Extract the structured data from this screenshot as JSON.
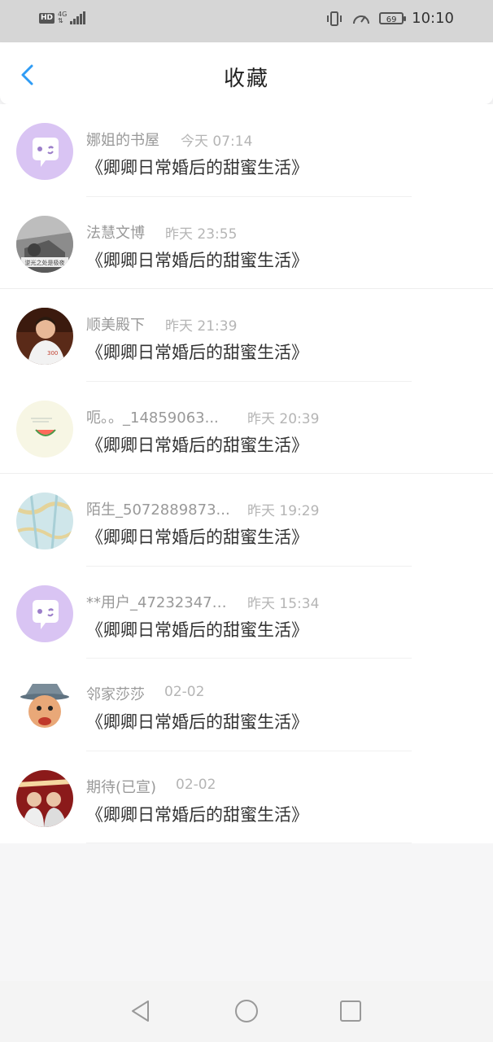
{
  "status_bar": {
    "hd": "HD",
    "network": "4G",
    "battery": "69",
    "time": "10:10"
  },
  "header": {
    "title": "收藏",
    "back_icon": "chevron-left-icon",
    "accent": "#2f9cf5"
  },
  "favorites": [
    {
      "user": "娜姐的书屋",
      "time": "今天 07:14",
      "book": "《卿卿日常婚后的甜蜜生活》"
    },
    {
      "user": "法慧文博",
      "time": "昨天 23:55",
      "book": "《卿卿日常婚后的甜蜜生活》"
    },
    {
      "user": "顺美殿下",
      "time": "昨天 21:39",
      "book": "《卿卿日常婚后的甜蜜生活》"
    },
    {
      "user": "呃。。_14859063...",
      "time": "昨天 20:39",
      "book": "《卿卿日常婚后的甜蜜生活》"
    },
    {
      "user": "陌生_5072889873...",
      "time": "昨天 19:29",
      "book": "《卿卿日常婚后的甜蜜生活》"
    },
    {
      "user": "**用户_472323473...",
      "time": "昨天 15:34",
      "book": "《卿卿日常婚后的甜蜜生活》"
    },
    {
      "user": "邻家莎莎",
      "time": "02-02",
      "book": "《卿卿日常婚后的甜蜜生活》"
    },
    {
      "user": "期待(已宣)",
      "time": "02-02",
      "book": "《卿卿日常婚后的甜蜜生活》"
    }
  ],
  "avatar_images": {
    "item2": "逆光之处是极夜"
  },
  "nav": {
    "back_icon": "triangle-back-icon",
    "home_icon": "circle-home-icon",
    "recent_icon": "square-recents-icon"
  }
}
